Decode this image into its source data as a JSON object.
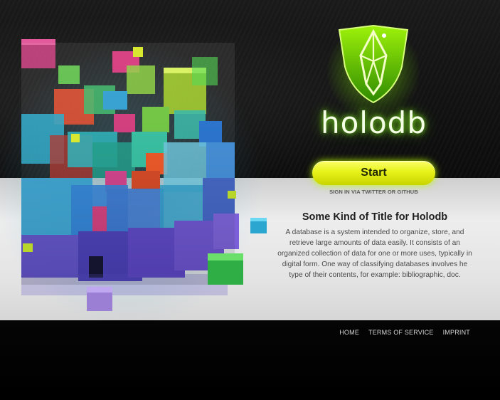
{
  "logo": {
    "text": "holodb",
    "icon": "holodb-shield-icon"
  },
  "start_button": {
    "label": "Start"
  },
  "signin_link": {
    "label": "SIGN IN VIA TWITTER OR GITHUB"
  },
  "content": {
    "title": "Some Kind of Title for Holodb",
    "body": "A database is a system intended to organize, store, and retrieve large amounts of data easily. It consists of an organized collection of data for one or more uses, typically in digital form. One way of classifying databases involves he type of their contents, for example: bibliographic, doc."
  },
  "footer": {
    "links": [
      "HOME",
      "TERMS OF SERVICE",
      "IMPRINT"
    ]
  },
  "colors": {
    "accent": "#c8f000",
    "logo_green": "#7ad400",
    "mid_band": "#e6e6e6",
    "footer": "#000000"
  }
}
